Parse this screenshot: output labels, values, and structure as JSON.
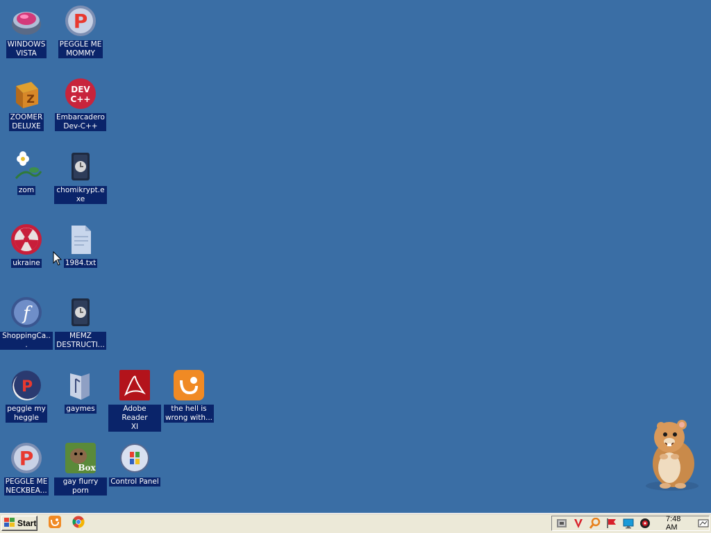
{
  "desktop": {
    "icons": [
      {
        "label": "WINDOWS\nVISTA",
        "icon": "windows-vista-orb-icon"
      },
      {
        "label": "PEGGLE ME\nMOMMY",
        "icon": "peggle-icon"
      },
      {
        "label": "ZOOMER\nDELUXE",
        "icon": "zoomer-cube-icon"
      },
      {
        "label": "Embarcadero\nDev-C++",
        "icon": "devcpp-icon"
      },
      {
        "label": "zom",
        "icon": "flower-icon"
      },
      {
        "label": "chomikrypt.exe",
        "icon": "exe-file-icon"
      },
      {
        "label": "ukraine",
        "icon": "radiation-icon"
      },
      {
        "label": "1984.txt",
        "icon": "text-file-icon"
      },
      {
        "label": "ShoppingCa...",
        "icon": "flash-icon"
      },
      {
        "label": "MEMZ\nDESTRUCTI...",
        "icon": "exe-file-icon"
      },
      {
        "label": "peggle my\nheggle",
        "icon": "peggle-moon-icon"
      },
      {
        "label": "gaymes",
        "icon": "folder-icon"
      },
      {
        "label": "Adobe Reader\nXI",
        "icon": "adobe-reader-icon"
      },
      {
        "label": "the hell is\nwrong with...",
        "icon": "uc-browser-icon"
      },
      {
        "label": "PEGGLE ME\nNECKBEA...",
        "icon": "peggle-icon"
      },
      {
        "label": "gay flurry porn",
        "icon": "box-beaver-icon"
      },
      {
        "label": "Control Panel",
        "icon": "control-panel-icon"
      }
    ]
  },
  "taskbar": {
    "start_label": "Start",
    "quick_launch": [
      "uc-browser-icon",
      "chrome-icon"
    ],
    "tray_icons": [
      "network-icon",
      "antivirus-v-icon",
      "search-tool-icon",
      "flag-icon",
      "monitor-icon",
      "media-icon"
    ],
    "clock": "7:48 AM"
  },
  "colors": {
    "desktop": "#3a6ea5",
    "label_bg": "#0a246a",
    "taskbar": "#ece9d8"
  }
}
